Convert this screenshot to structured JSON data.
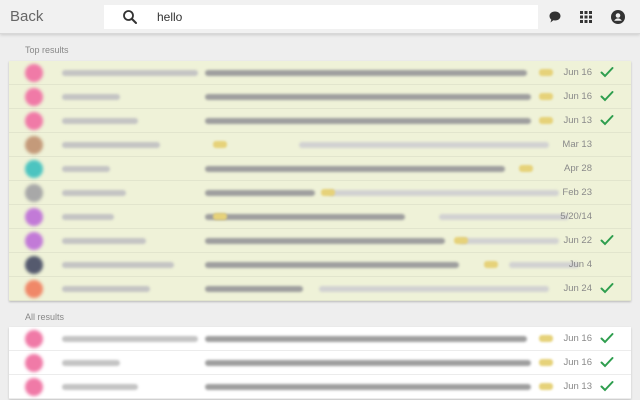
{
  "header": {
    "back_label": "Back",
    "search_value": "hello"
  },
  "icons": {
    "search": "search-icon",
    "chat": "chat-bubble-icon",
    "apps": "apps-grid-icon",
    "account": "account-icon",
    "check": "checkmark-icon"
  },
  "colors": {
    "top_results_bg": "#eff2d8",
    "check": "#2e9e4e",
    "avatar_pink": "#f07aa7",
    "avatar_teal": "#4cc4c0",
    "avatar_purple": "#c27ad7",
    "avatar_gray": "#a8a8a8",
    "avatar_orange": "#f08868"
  },
  "top_results": {
    "label": "Top results",
    "rows": [
      {
        "date": "Jun 16",
        "checked": true
      },
      {
        "date": "Jun 16",
        "checked": true
      },
      {
        "date": "Jun 13",
        "checked": true
      },
      {
        "date": "Mar 13",
        "checked": false
      },
      {
        "date": "Apr 28",
        "checked": false
      },
      {
        "date": "Feb 23",
        "checked": false
      },
      {
        "date": "5/20/14",
        "checked": false
      },
      {
        "date": "Jun 22",
        "checked": true
      },
      {
        "date": "Jun 4",
        "checked": false
      },
      {
        "date": "Jun 24",
        "checked": true
      }
    ]
  },
  "all_results": {
    "label": "All results",
    "rows": [
      {
        "date": "Jun 16",
        "checked": true
      },
      {
        "date": "Jun 16",
        "checked": true
      },
      {
        "date": "Jun 13",
        "checked": true
      }
    ]
  }
}
